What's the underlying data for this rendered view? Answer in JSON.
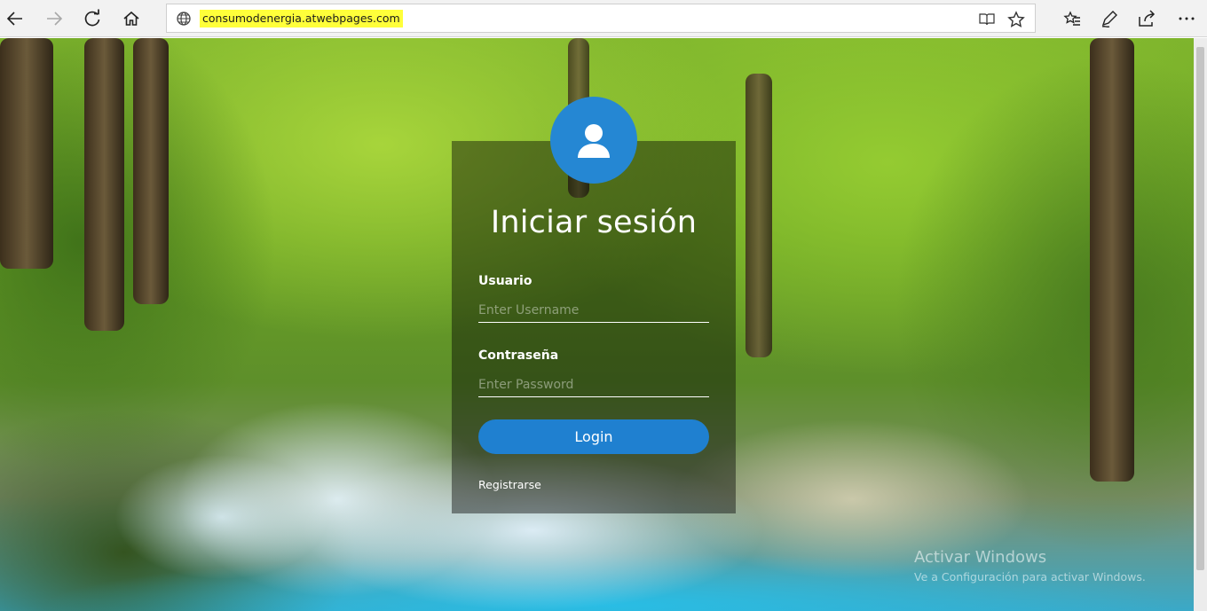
{
  "browser": {
    "url": "consumodenergia.atwebpages.com",
    "icons": {
      "back": "back-arrow-icon",
      "forward": "forward-arrow-icon",
      "refresh": "refresh-icon",
      "home": "home-icon",
      "site_info": "globe-icon",
      "reading_view": "reading-view-icon",
      "favorite": "star-icon",
      "favorites_hub": "favorites-list-icon",
      "notes": "pen-icon",
      "share": "share-icon",
      "more": "more-icon"
    }
  },
  "login": {
    "title": "Iniciar sesión",
    "username_label": "Usuario",
    "username_placeholder": "Enter Username",
    "password_label": "Contraseña",
    "password_placeholder": "Enter Password",
    "login_button": "Login",
    "register_link": "Registrarse",
    "colors": {
      "accent": "#2587d3",
      "panel": "rgba(0,0,0,0.42)"
    }
  },
  "watermark": {
    "title": "Activar Windows",
    "subtitle": "Ve a Configuración para activar Windows."
  }
}
